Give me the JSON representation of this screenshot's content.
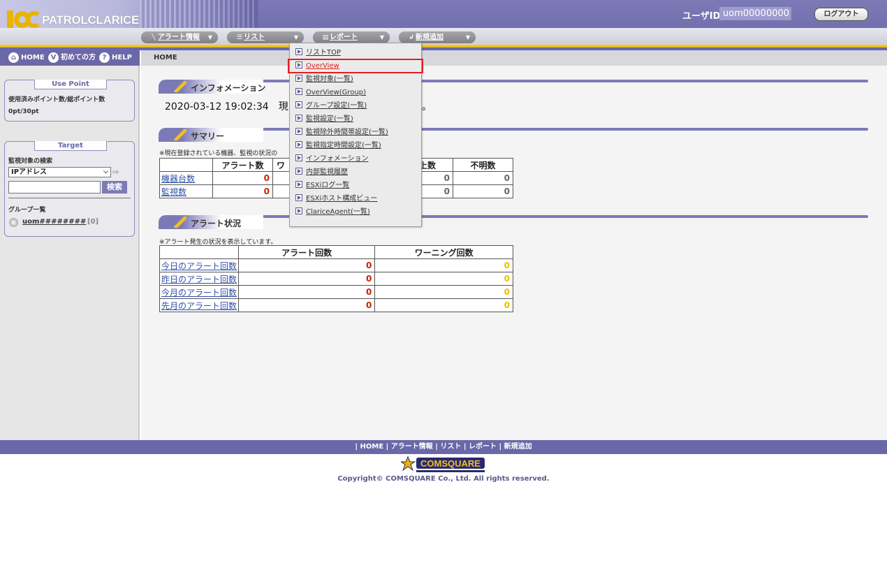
{
  "header": {
    "logo_text": "PATROLCLARICE",
    "user_label": "ユーザID",
    "user_id": "uom00000000",
    "logout_label": "ログアウト",
    "menus": [
      {
        "label": "アラート情報",
        "icon": "alert-icon"
      },
      {
        "label": "リスト",
        "icon": "list-icon"
      },
      {
        "label": "レポート",
        "icon": "report-icon"
      },
      {
        "label": "新規追加",
        "icon": "add-icon"
      }
    ]
  },
  "sidebar": {
    "nav": [
      {
        "label": "HOME",
        "icon": "home-icon"
      },
      {
        "label": "初めての方",
        "icon": "beginner-icon"
      },
      {
        "label": "HELP",
        "icon": "help-icon"
      }
    ],
    "use_point": {
      "title": "Use Point",
      "label": "使用済みポイント数/総ポイント数",
      "value": "0pt/30pt"
    },
    "target": {
      "title": "Target",
      "search_label": "監視対象の検索",
      "select_value": "IPアドレス",
      "search_button": "検索",
      "group_label": "グループ一覧",
      "group_name": "uom########",
      "group_count": "[0]"
    }
  },
  "breadcrumb": "HOME",
  "main": {
    "info": {
      "title": "インフォメーション",
      "line": "2020-03-12 19:02:34　現",
      "line_tail": "。"
    },
    "summary": {
      "title": "サマリー",
      "note": "※現在登録されている機器、監視の状況の",
      "headers": [
        "",
        "アラート数",
        "ワ",
        "",
        "上数",
        "不明数"
      ],
      "rows": [
        {
          "label": "機器台数",
          "alert": "0",
          "c5": "0",
          "c6": "0"
        },
        {
          "label": "監視数",
          "alert": "0",
          "c5": "0",
          "c6": "0"
        }
      ]
    },
    "alert_status": {
      "title": "アラート状況",
      "note": "※アラート発生の状況を表示しています。",
      "headers": [
        "",
        "アラート回数",
        "ワーニング回数"
      ],
      "rows": [
        {
          "label": "今日のアラート回数",
          "alert": "0",
          "warn": "0"
        },
        {
          "label": "昨日のアラート回数",
          "alert": "0",
          "warn": "0"
        },
        {
          "label": "今月のアラート回数",
          "alert": "0",
          "warn": "0"
        },
        {
          "label": "先月のアラート回数",
          "alert": "0",
          "warn": "0"
        }
      ]
    }
  },
  "dropdown": {
    "items": [
      "リストTOP",
      "OverView",
      "監視対象(一覧)",
      "OverView(Group)",
      "グループ設定(一覧)",
      "監視設定(一覧)",
      "監視除外時間帯設定(一覧)",
      "監視指定時間設定(一覧)",
      "インフォメーション",
      "内部監視履歴",
      "ESXiログ一覧",
      "ESXiホスト構成ビュー",
      "ClariceAgent(一覧)"
    ],
    "highlighted": "OverView"
  },
  "footer": {
    "links": "| HOME | アラート情報 | リスト | レポート | 新規追加",
    "logo_text": "COMSQUARE",
    "copyright": "Copyright© COMSQUARE Co., Ltd. All rights reserved."
  },
  "colors": {
    "brand": "#6a68a8",
    "accent_yellow": "#e8b400",
    "alert_red": "#cc2200",
    "highlight_border": "#e02020"
  }
}
